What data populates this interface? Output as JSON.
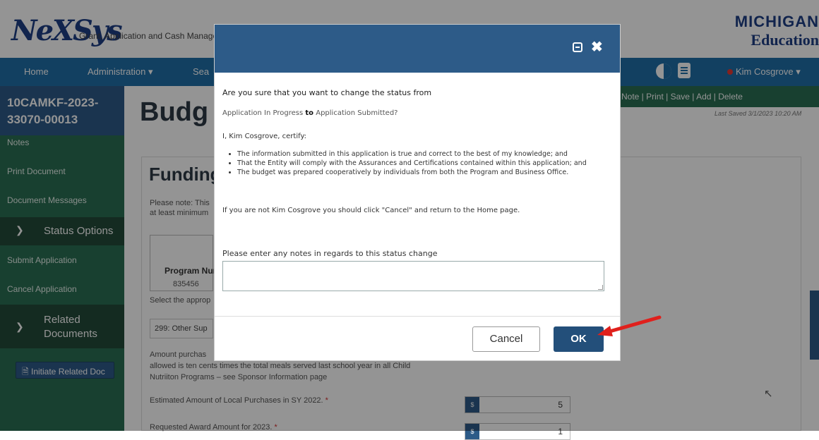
{
  "header": {
    "logo_text": "NeXSys",
    "logo_subtitle": "Grant, Application and Cash Manage",
    "agency_logo_line1": "MICHIGAN",
    "agency_logo_line2": "Education"
  },
  "navbar": {
    "home": "Home",
    "administration": "Administration ▾",
    "search": "Sea",
    "user": "Kim Cosgrove ▾"
  },
  "sidebar": {
    "document_id": "10CAMKF-2023-\n33070-00013",
    "links": [
      "Notes",
      "Print Document",
      "Document Messages"
    ],
    "status_section": "Status Options",
    "status_links": [
      "Submit Application",
      "Cancel Application"
    ],
    "related_section": "Related Documents",
    "initiate_button": "Initiate Related Doc"
  },
  "page": {
    "title": "Budg",
    "actions": "w Note  |  Print  |  Save  |  Add  |  Delete",
    "last_saved": "Last Saved 3/1/2023 10:20 AM",
    "panel_title": "Funding",
    "note_line1": "Please note: This",
    "note_line2": "at least minimum",
    "table_header": "Program Nur",
    "table_value": "835456",
    "select_label": "Select the approp",
    "select_value": "299: Other Sup",
    "amount_line1": "Amount purchas",
    "amount_line2": "allowed is ten cents times the total meals served last school year in all Child",
    "amount_line3": "Nutriiton Programs – see Sponsor Information page",
    "estimated_label": "Estimated Amount of Local Purchases in SY 2022.",
    "estimated_currency": "$",
    "estimated_value": "5",
    "requested_label": "Requested Award Amount for 2023.",
    "requested_currency": "$",
    "requested_value": "1",
    "required_mark": "*"
  },
  "modal": {
    "question": "Are you sure that you want to change the status from",
    "from_status": "Application In Progress",
    "to_word": "to",
    "to_status": "Application Submitted?",
    "certify": "I, Kim Cosgrove, certify:",
    "bullets": [
      "The information submitted in this application is true and correct to the best of my knowledge; and",
      "That the Entity will comply with the Assurances and Certifications contained within this application; and",
      "The budget was prepared cooperatively by individuals from both the Program and Business Office."
    ],
    "not_user_note": "If you are not Kim Cosgrove you should click \"Cancel\" and return to the Home page.",
    "notes_label": "Please enter any notes in regards to this status change",
    "notes_value": "",
    "cancel_label": "Cancel",
    "ok_label": "OK"
  },
  "colors": {
    "navbar": "#1f6fa8",
    "sidebar": "#2a6e53",
    "modal_header": "#2d5b88",
    "ok_button": "#234f7a",
    "annotation_arrow": "#e0201c"
  },
  "icons": [
    "maximize-icon",
    "close-icon",
    "contrast-icon",
    "document-icon",
    "chevron-down-icon",
    "arrow-annotation-icon"
  ]
}
